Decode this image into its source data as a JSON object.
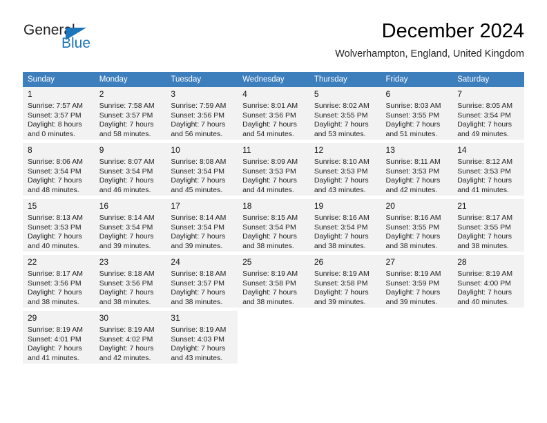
{
  "logo": {
    "word_one": "General",
    "word_two": "Blue",
    "triangle_icon": "triangle-icon",
    "accent_color": "#1b75bb"
  },
  "header": {
    "title": "December 2024",
    "subtitle": "Wolverhampton, England, United Kingdom"
  },
  "theme": {
    "header_row_color": "#3d7ebd",
    "shaded_row_color": "#f2f2f2",
    "text_color": "#222222"
  },
  "weekdays": [
    "Sunday",
    "Monday",
    "Tuesday",
    "Wednesday",
    "Thursday",
    "Friday",
    "Saturday"
  ],
  "weeks": [
    {
      "shaded": true,
      "days": [
        {
          "num": "1",
          "sunrise": "Sunrise: 7:57 AM",
          "sunset": "Sunset: 3:57 PM",
          "daylight1": "Daylight: 8 hours",
          "daylight2": "and 0 minutes."
        },
        {
          "num": "2",
          "sunrise": "Sunrise: 7:58 AM",
          "sunset": "Sunset: 3:57 PM",
          "daylight1": "Daylight: 7 hours",
          "daylight2": "and 58 minutes."
        },
        {
          "num": "3",
          "sunrise": "Sunrise: 7:59 AM",
          "sunset": "Sunset: 3:56 PM",
          "daylight1": "Daylight: 7 hours",
          "daylight2": "and 56 minutes."
        },
        {
          "num": "4",
          "sunrise": "Sunrise: 8:01 AM",
          "sunset": "Sunset: 3:56 PM",
          "daylight1": "Daylight: 7 hours",
          "daylight2": "and 54 minutes."
        },
        {
          "num": "5",
          "sunrise": "Sunrise: 8:02 AM",
          "sunset": "Sunset: 3:55 PM",
          "daylight1": "Daylight: 7 hours",
          "daylight2": "and 53 minutes."
        },
        {
          "num": "6",
          "sunrise": "Sunrise: 8:03 AM",
          "sunset": "Sunset: 3:55 PM",
          "daylight1": "Daylight: 7 hours",
          "daylight2": "and 51 minutes."
        },
        {
          "num": "7",
          "sunrise": "Sunrise: 8:05 AM",
          "sunset": "Sunset: 3:54 PM",
          "daylight1": "Daylight: 7 hours",
          "daylight2": "and 49 minutes."
        }
      ]
    },
    {
      "shaded": true,
      "days": [
        {
          "num": "8",
          "sunrise": "Sunrise: 8:06 AM",
          "sunset": "Sunset: 3:54 PM",
          "daylight1": "Daylight: 7 hours",
          "daylight2": "and 48 minutes."
        },
        {
          "num": "9",
          "sunrise": "Sunrise: 8:07 AM",
          "sunset": "Sunset: 3:54 PM",
          "daylight1": "Daylight: 7 hours",
          "daylight2": "and 46 minutes."
        },
        {
          "num": "10",
          "sunrise": "Sunrise: 8:08 AM",
          "sunset": "Sunset: 3:54 PM",
          "daylight1": "Daylight: 7 hours",
          "daylight2": "and 45 minutes."
        },
        {
          "num": "11",
          "sunrise": "Sunrise: 8:09 AM",
          "sunset": "Sunset: 3:53 PM",
          "daylight1": "Daylight: 7 hours",
          "daylight2": "and 44 minutes."
        },
        {
          "num": "12",
          "sunrise": "Sunrise: 8:10 AM",
          "sunset": "Sunset: 3:53 PM",
          "daylight1": "Daylight: 7 hours",
          "daylight2": "and 43 minutes."
        },
        {
          "num": "13",
          "sunrise": "Sunrise: 8:11 AM",
          "sunset": "Sunset: 3:53 PM",
          "daylight1": "Daylight: 7 hours",
          "daylight2": "and 42 minutes."
        },
        {
          "num": "14",
          "sunrise": "Sunrise: 8:12 AM",
          "sunset": "Sunset: 3:53 PM",
          "daylight1": "Daylight: 7 hours",
          "daylight2": "and 41 minutes."
        }
      ]
    },
    {
      "shaded": true,
      "days": [
        {
          "num": "15",
          "sunrise": "Sunrise: 8:13 AM",
          "sunset": "Sunset: 3:53 PM",
          "daylight1": "Daylight: 7 hours",
          "daylight2": "and 40 minutes."
        },
        {
          "num": "16",
          "sunrise": "Sunrise: 8:14 AM",
          "sunset": "Sunset: 3:54 PM",
          "daylight1": "Daylight: 7 hours",
          "daylight2": "and 39 minutes."
        },
        {
          "num": "17",
          "sunrise": "Sunrise: 8:14 AM",
          "sunset": "Sunset: 3:54 PM",
          "daylight1": "Daylight: 7 hours",
          "daylight2": "and 39 minutes."
        },
        {
          "num": "18",
          "sunrise": "Sunrise: 8:15 AM",
          "sunset": "Sunset: 3:54 PM",
          "daylight1": "Daylight: 7 hours",
          "daylight2": "and 38 minutes."
        },
        {
          "num": "19",
          "sunrise": "Sunrise: 8:16 AM",
          "sunset": "Sunset: 3:54 PM",
          "daylight1": "Daylight: 7 hours",
          "daylight2": "and 38 minutes."
        },
        {
          "num": "20",
          "sunrise": "Sunrise: 8:16 AM",
          "sunset": "Sunset: 3:55 PM",
          "daylight1": "Daylight: 7 hours",
          "daylight2": "and 38 minutes."
        },
        {
          "num": "21",
          "sunrise": "Sunrise: 8:17 AM",
          "sunset": "Sunset: 3:55 PM",
          "daylight1": "Daylight: 7 hours",
          "daylight2": "and 38 minutes."
        }
      ]
    },
    {
      "shaded": true,
      "days": [
        {
          "num": "22",
          "sunrise": "Sunrise: 8:17 AM",
          "sunset": "Sunset: 3:56 PM",
          "daylight1": "Daylight: 7 hours",
          "daylight2": "and 38 minutes."
        },
        {
          "num": "23",
          "sunrise": "Sunrise: 8:18 AM",
          "sunset": "Sunset: 3:56 PM",
          "daylight1": "Daylight: 7 hours",
          "daylight2": "and 38 minutes."
        },
        {
          "num": "24",
          "sunrise": "Sunrise: 8:18 AM",
          "sunset": "Sunset: 3:57 PM",
          "daylight1": "Daylight: 7 hours",
          "daylight2": "and 38 minutes."
        },
        {
          "num": "25",
          "sunrise": "Sunrise: 8:19 AM",
          "sunset": "Sunset: 3:58 PM",
          "daylight1": "Daylight: 7 hours",
          "daylight2": "and 38 minutes."
        },
        {
          "num": "26",
          "sunrise": "Sunrise: 8:19 AM",
          "sunset": "Sunset: 3:58 PM",
          "daylight1": "Daylight: 7 hours",
          "daylight2": "and 39 minutes."
        },
        {
          "num": "27",
          "sunrise": "Sunrise: 8:19 AM",
          "sunset": "Sunset: 3:59 PM",
          "daylight1": "Daylight: 7 hours",
          "daylight2": "and 39 minutes."
        },
        {
          "num": "28",
          "sunrise": "Sunrise: 8:19 AM",
          "sunset": "Sunset: 4:00 PM",
          "daylight1": "Daylight: 7 hours",
          "daylight2": "and 40 minutes."
        }
      ]
    },
    {
      "shaded": true,
      "days": [
        {
          "num": "29",
          "sunrise": "Sunrise: 8:19 AM",
          "sunset": "Sunset: 4:01 PM",
          "daylight1": "Daylight: 7 hours",
          "daylight2": "and 41 minutes."
        },
        {
          "num": "30",
          "sunrise": "Sunrise: 8:19 AM",
          "sunset": "Sunset: 4:02 PM",
          "daylight1": "Daylight: 7 hours",
          "daylight2": "and 42 minutes."
        },
        {
          "num": "31",
          "sunrise": "Sunrise: 8:19 AM",
          "sunset": "Sunset: 4:03 PM",
          "daylight1": "Daylight: 7 hours",
          "daylight2": "and 43 minutes."
        },
        {
          "num": "",
          "sunrise": "",
          "sunset": "",
          "daylight1": "",
          "daylight2": ""
        },
        {
          "num": "",
          "sunrise": "",
          "sunset": "",
          "daylight1": "",
          "daylight2": ""
        },
        {
          "num": "",
          "sunrise": "",
          "sunset": "",
          "daylight1": "",
          "daylight2": ""
        },
        {
          "num": "",
          "sunrise": "",
          "sunset": "",
          "daylight1": "",
          "daylight2": ""
        }
      ]
    }
  ]
}
